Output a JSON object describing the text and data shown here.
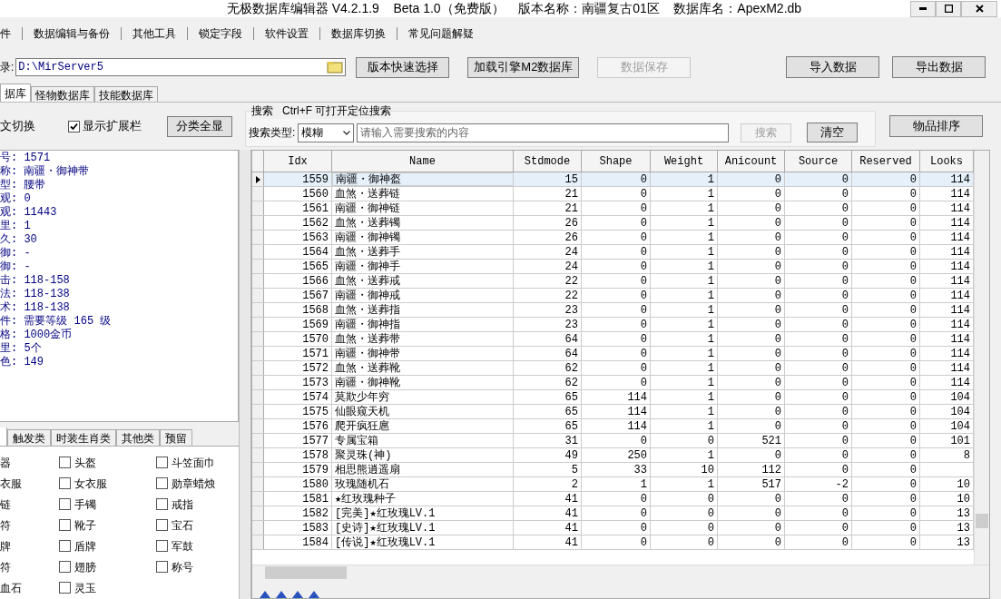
{
  "window": {
    "title": "无极数据库编辑器 V4.2.1.9    Beta 1.0（免费版）    版本名称：南疆复古01区    数据库名：ApexM2.db"
  },
  "menu": [
    "件",
    "数据编辑与备份",
    "其他工具",
    "锁定字段",
    "软件设置",
    "数据库切换",
    "常见问题解疑"
  ],
  "path": {
    "label": "录:",
    "value": "D:\\MirServer5"
  },
  "toolbar_buttons": [
    {
      "label": "版本快速选择",
      "disabled": false
    },
    {
      "label": "加载引擎M2数据库",
      "disabled": false
    },
    {
      "label": "数据保存",
      "disabled": true
    }
  ],
  "data_buttons": [
    "导入数据",
    "导出数据"
  ],
  "tabs": [
    {
      "label": "据库",
      "selected": true
    },
    {
      "label": "怪物数据库",
      "selected": false
    },
    {
      "label": "技能数据库",
      "selected": false
    }
  ],
  "options": {
    "switch_label": "文切换",
    "show_ext": {
      "label": "显示扩展栏",
      "checked": true
    },
    "show_all": "分类全显"
  },
  "search": {
    "legend": "搜索   Ctrl+F 可打开定位搜索",
    "type_label": "搜索类型:",
    "type_value": "模糊",
    "placeholder": "请输入需要搜索的内容",
    "search_button": "搜索",
    "clear_button": "清空",
    "sort_button": "物品排序"
  },
  "info": [
    "号: 1571",
    "称: 南疆・御神带",
    "型: 腰带",
    "观: 0",
    "观: 11443",
    "里: 1",
    "久: 30",
    "御: -",
    "御: -",
    "击: 118-158",
    "法: 118-138",
    "术: 118-138",
    "件: 需要等级 165 级",
    "格: 1000金币",
    "里: 5个",
    "色: 149"
  ],
  "category_tabs": [
    "触发类",
    "时装生肖类",
    "其他类",
    "预留"
  ],
  "cut_categories": [
    "器",
    "衣服",
    "链",
    "符",
    "牌",
    "符",
    "血石"
  ],
  "categories": [
    {
      "label": "头盔",
      "checked": false
    },
    {
      "label": "斗笠面巾",
      "checked": false
    },
    {
      "label": "女衣服",
      "checked": false
    },
    {
      "label": "勋章蜡烛",
      "checked": false
    },
    {
      "label": "手镯",
      "checked": false
    },
    {
      "label": "戒指",
      "checked": false
    },
    {
      "label": "靴子",
      "checked": false
    },
    {
      "label": "宝石",
      "checked": false
    },
    {
      "label": "盾牌",
      "checked": false
    },
    {
      "label": "军鼓",
      "checked": false
    },
    {
      "label": "翅膀",
      "checked": false
    },
    {
      "label": "称号",
      "checked": false
    },
    {
      "label": "灵玉",
      "checked": false
    }
  ],
  "table": {
    "columns": [
      "Idx",
      "Name",
      "Stdmode",
      "Shape",
      "Weight",
      "Anicount",
      "Source",
      "Reserved",
      "Looks"
    ],
    "rows": [
      {
        "selected": true,
        "cells": [
          "1559",
          "南疆・御神盔",
          "15",
          "0",
          "1",
          "0",
          "0",
          "0",
          "114"
        ]
      },
      {
        "selected": false,
        "cells": [
          "1560",
          "血煞・送葬链",
          "21",
          "0",
          "1",
          "0",
          "0",
          "0",
          "114"
        ]
      },
      {
        "selected": false,
        "cells": [
          "1561",
          "南疆・御神链",
          "21",
          "0",
          "1",
          "0",
          "0",
          "0",
          "114"
        ]
      },
      {
        "selected": false,
        "cells": [
          "1562",
          "血煞・送葬镯",
          "26",
          "0",
          "1",
          "0",
          "0",
          "0",
          "114"
        ]
      },
      {
        "selected": false,
        "cells": [
          "1563",
          "南疆・御神镯",
          "26",
          "0",
          "1",
          "0",
          "0",
          "0",
          "114"
        ]
      },
      {
        "selected": false,
        "cells": [
          "1564",
          "血煞・送葬手",
          "24",
          "0",
          "1",
          "0",
          "0",
          "0",
          "114"
        ]
      },
      {
        "selected": false,
        "cells": [
          "1565",
          "南疆・御神手",
          "24",
          "0",
          "1",
          "0",
          "0",
          "0",
          "114"
        ]
      },
      {
        "selected": false,
        "cells": [
          "1566",
          "血煞・送葬戒",
          "22",
          "0",
          "1",
          "0",
          "0",
          "0",
          "114"
        ]
      },
      {
        "selected": false,
        "cells": [
          "1567",
          "南疆・御神戒",
          "22",
          "0",
          "1",
          "0",
          "0",
          "0",
          "114"
        ]
      },
      {
        "selected": false,
        "cells": [
          "1568",
          "血煞・送葬指",
          "23",
          "0",
          "1",
          "0",
          "0",
          "0",
          "114"
        ]
      },
      {
        "selected": false,
        "cells": [
          "1569",
          "南疆・御神指",
          "23",
          "0",
          "1",
          "0",
          "0",
          "0",
          "114"
        ]
      },
      {
        "selected": false,
        "cells": [
          "1570",
          "血煞・送葬带",
          "64",
          "0",
          "1",
          "0",
          "0",
          "0",
          "114"
        ]
      },
      {
        "selected": false,
        "cells": [
          "1571",
          "南疆・御神带",
          "64",
          "0",
          "1",
          "0",
          "0",
          "0",
          "114"
        ]
      },
      {
        "selected": false,
        "cells": [
          "1572",
          "血煞・送葬靴",
          "62",
          "0",
          "1",
          "0",
          "0",
          "0",
          "114"
        ]
      },
      {
        "selected": false,
        "cells": [
          "1573",
          "南疆・御神靴",
          "62",
          "0",
          "1",
          "0",
          "0",
          "0",
          "114"
        ]
      },
      {
        "selected": false,
        "cells": [
          "1574",
          "莫欺少年穷",
          "65",
          "114",
          "1",
          "0",
          "0",
          "0",
          "104"
        ]
      },
      {
        "selected": false,
        "cells": [
          "1575",
          "仙眼窥天机",
          "65",
          "114",
          "1",
          "0",
          "0",
          "0",
          "104"
        ]
      },
      {
        "selected": false,
        "cells": [
          "1576",
          "爬开疯狂扈",
          "65",
          "114",
          "1",
          "0",
          "0",
          "0",
          "104"
        ]
      },
      {
        "selected": false,
        "cells": [
          "1577",
          "专属宝箱",
          "31",
          "0",
          "0",
          "521",
          "0",
          "0",
          "101"
        ]
      },
      {
        "selected": false,
        "cells": [
          "1578",
          "聚灵珠(神)",
          "49",
          "250",
          "1",
          "0",
          "0",
          "0",
          "8"
        ]
      },
      {
        "selected": false,
        "cells": [
          "1579",
          "相思熊逍遥扇",
          "5",
          "33",
          "10",
          "112",
          "0",
          "0",
          ""
        ]
      },
      {
        "selected": false,
        "cells": [
          "1580",
          "玫瑰随机石",
          "2",
          "1",
          "1",
          "517",
          "-2",
          "0",
          "10"
        ]
      },
      {
        "selected": false,
        "cells": [
          "1581",
          "★红玫瑰种子",
          "41",
          "0",
          "0",
          "0",
          "0",
          "0",
          "10"
        ]
      },
      {
        "selected": false,
        "cells": [
          "1582",
          "[完美]★红玫瑰LV.1",
          "41",
          "0",
          "0",
          "0",
          "0",
          "0",
          "13"
        ]
      },
      {
        "selected": false,
        "cells": [
          "1583",
          "[史诗]★红玫瑰LV.1",
          "41",
          "0",
          "0",
          "0",
          "0",
          "0",
          "13"
        ]
      },
      {
        "selected": false,
        "cells": [
          "1584",
          "[传说]★红玫瑰LV.1",
          "41",
          "0",
          "0",
          "0",
          "0",
          "0",
          "13"
        ]
      }
    ]
  }
}
